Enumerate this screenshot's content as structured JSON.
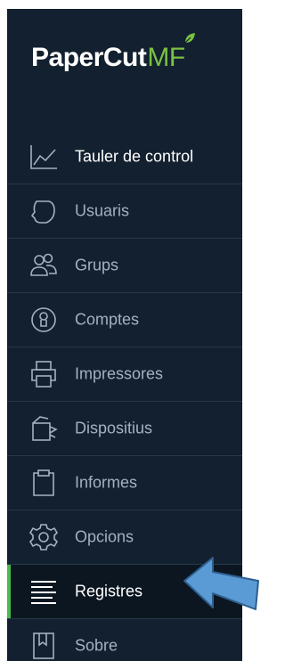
{
  "brand": {
    "name": "PaperCut",
    "suffix": "MF",
    "accent": "#7ac143"
  },
  "sidebar": {
    "background": "#13202f",
    "active_marker_color": "#4cbb4a",
    "items": [
      {
        "label": "Tauler de control",
        "icon": "dashboard-chart-icon",
        "state": "highlighted"
      },
      {
        "label": "Usuaris",
        "icon": "user-head-icon",
        "state": "normal"
      },
      {
        "label": "Grups",
        "icon": "group-icon",
        "state": "normal"
      },
      {
        "label": "Comptes",
        "icon": "account-icon",
        "state": "normal"
      },
      {
        "label": "Impressores",
        "icon": "printer-icon",
        "state": "normal"
      },
      {
        "label": "Dispositius",
        "icon": "device-icon",
        "state": "normal"
      },
      {
        "label": "Informes",
        "icon": "clipboard-icon",
        "state": "normal"
      },
      {
        "label": "Opcions",
        "icon": "gear-icon",
        "state": "normal"
      },
      {
        "label": "Registres",
        "icon": "list-lines-icon",
        "state": "active"
      },
      {
        "label": "Sobre",
        "icon": "book-icon",
        "state": "normal"
      }
    ]
  },
  "annotation": {
    "icon": "pointer-arrow-icon",
    "color": "#5b9bd5"
  }
}
